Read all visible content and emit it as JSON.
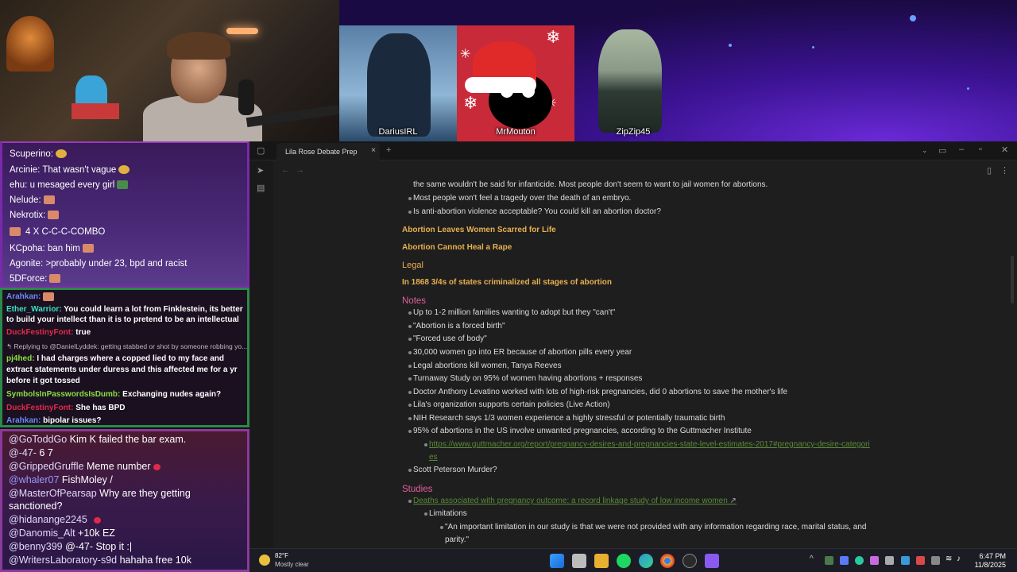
{
  "guests": [
    {
      "name": "DariusIRL"
    },
    {
      "name": "MrMouton"
    },
    {
      "name": "ZipZip45"
    }
  ],
  "chat_top": [
    {
      "text": "Scuperino:"
    },
    {
      "text": "Arcinie: That wasn't vague"
    },
    {
      "text": "ehu: u mesaged every girl"
    },
    {
      "text": "Nelude:"
    },
    {
      "text": "Nekrotix:"
    },
    {
      "text": "4 X C-C-C-COMBO"
    },
    {
      "text": "KCpoha: ban him"
    },
    {
      "text": "Agonite: >probably under 23, bpd and racist"
    },
    {
      "text": "5DForce:"
    }
  ],
  "chat_mid": {
    "l1_name": "Arahkan:",
    "l2_name": "Ether_Warrior:",
    "l2_text": "You could learn a lot from Finklestein, its better",
    "l2b_text": "to build your intellect than it is to pretend to be an intellectual",
    "l3_name": "DuckFestinyFont:",
    "l3_text": "true",
    "l4_text": "↰ Replying to @DanielLyddek: getting stabbed or shot by someone robbing yo...",
    "l5_name": "pj4hed:",
    "l5_text": "I had charges where a copped lied to my face and",
    "l5b_text": "extract statements under duress and this affected me for a yr",
    "l5c_text": "before it got tossed",
    "l6_name": "SymbolsInPasswordsIsDumb:",
    "l6_text": "Exchanging nudes again?",
    "l7_name": "DuckFestinyFont:",
    "l7_text": "She has BPD",
    "l8_name": "Arahkan:",
    "l8_text": "bipolar issues?"
  },
  "chat_bot": [
    {
      "name": "@GoToddGo",
      "text": "Kim K failed the bar exam."
    },
    {
      "name": "@-47-",
      "text": "6 7"
    },
    {
      "name": "@GrippedGruffle",
      "text": "Meme number"
    },
    {
      "name": "@whaler07",
      "text": "FishMoley /"
    },
    {
      "name": "@MasterOfPearsap",
      "text": "Why are they getting"
    },
    {
      "name": "",
      "text": "sanctioned?"
    },
    {
      "name": "@hidanange2245",
      "text": ""
    },
    {
      "name": "@Danomis_Alt",
      "text": "+10k EZ"
    },
    {
      "name": "@benny399",
      "text": "@-47- Stop it :|"
    },
    {
      "name": "@WritersLaboratory-s9d",
      "text": "hahaha free 10k"
    }
  ],
  "window": {
    "tab_title": "Lila Rose Debate Prep",
    "tab_close": "×",
    "new_tab": "+"
  },
  "notes": {
    "intro": [
      "the same wouldn't be said for infanticide. Most people don't seem to want to jail women for abortions.",
      "Most people won't feel a tragedy over the death of an embryo.",
      "Is anti-abortion violence acceptable? You could kill an abortion doctor?"
    ],
    "h_scarred": "Abortion Leaves Women Scarred for Life",
    "h_rape": "Abortion Cannot Heal a Rape",
    "h_legal": "Legal",
    "h_1868": "In 1868 3/4s of states criminalized all stages of abortion",
    "h_notes": "Notes",
    "notes_items": [
      "Up to 1-2 million families wanting to adopt but they \"can't\"",
      "\"Abortion is a forced birth\"",
      "\"Forced use of body\"",
      "30,000 women go into ER because of abortion pills every year",
      "Legal abortions kill women, Tanya Reeves",
      "Turnaway Study on 95% of women having abortions + responses",
      "Doctor Anthony Levatino worked with lots of high-risk pregnancies, did 0 abortions to save the mother's life",
      "Lila's organization supports certain policies (Live Action)",
      "NIH Research says 1/3 women experience a highly stressful or potentially traumatic birth",
      "95% of abortions in the US involve unwanted pregnancies, according to the Guttmacher Institute"
    ],
    "guttmacher_link_1": "https://www.guttmacher.org/report/pregnancy-desires-and-pregnancies-state-level-estimates-2017#pregnancy-desire-categori",
    "guttmacher_link_2": "es",
    "peterson": "Scott Peterson Murder?",
    "h_studies": "Studies",
    "study_link": "Deaths associated with pregnancy outcome: a record linkage study of low income women",
    "limitations": "Limitations",
    "quote_1": "\"An important limitation in our study is that we were not provided with any information regarding race, marital status, and",
    "quote_2": "parity.\""
  },
  "taskbar": {
    "temp": "82°F",
    "weather": "Mostly clear",
    "time": "6:47 PM",
    "date": "11/8/2025"
  }
}
